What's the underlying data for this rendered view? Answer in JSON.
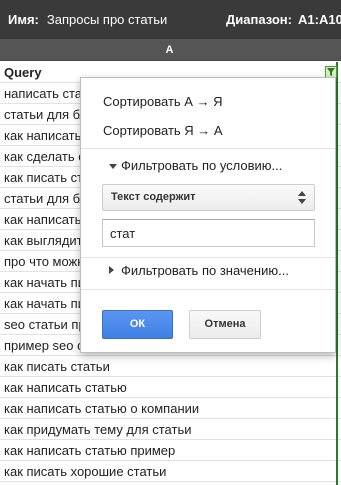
{
  "filter_bar": {
    "name_label": "Имя:",
    "name_value": "Запросы про статьи",
    "range_label": "Диапазон:",
    "range_value": "A1:A10"
  },
  "column_header": {
    "letter": "A"
  },
  "table": {
    "header": "Query",
    "rows": [
      "написать статью",
      "статьи для блога",
      "как написать статью",
      "как сделать статью",
      "как писать статьи",
      "статьи для блога",
      "как написать статью",
      "как выглядит статья",
      "про что можно написать статью",
      "как начать писать статью",
      "как начать писать статью",
      "seo статьи примеры",
      "пример seo статьи",
      "как писать статьи",
      "как написать статью",
      "как написать статью о компании",
      "как придумать тему для статьи",
      "как написать статью пример",
      "как писать хорошие статьи"
    ]
  },
  "popup": {
    "sort_az": "Сортировать А → Я",
    "sort_za": "Сортировать Я → А",
    "filter_by_condition": "Фильтровать по условию...",
    "condition_select": "Текст содержит",
    "condition_value": "стат",
    "filter_by_value": "Фильтровать по значению...",
    "ok_label": "ОК",
    "cancel_label": "Отмена"
  },
  "colors": {
    "topbar": "#3a3a3a",
    "column_header": "#555555",
    "ok_button": "#4a8af4",
    "filter_green": "#2b7a2b"
  }
}
